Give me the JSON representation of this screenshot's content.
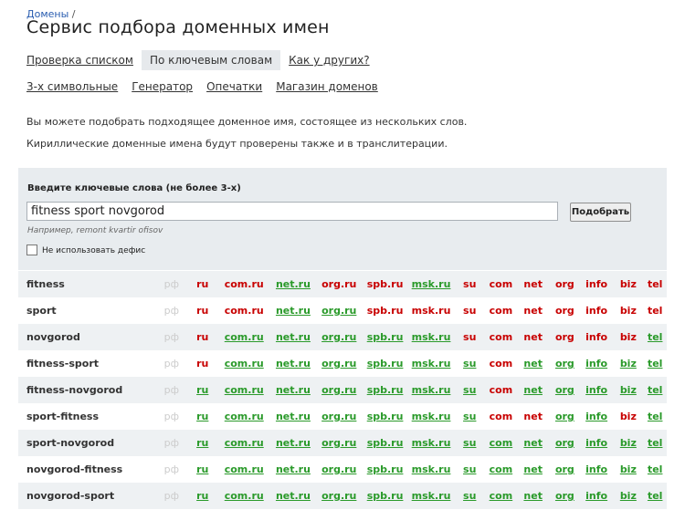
{
  "breadcrumb": {
    "link": "Домены",
    "separator": "/"
  },
  "title": "Сервис подбора доменных имен",
  "tabs": [
    {
      "label": "Проверка списком",
      "active": false
    },
    {
      "label": "По ключевым словам",
      "active": true
    },
    {
      "label": "Как у других?",
      "active": false
    }
  ],
  "subnav": [
    "3-х символьные",
    "Генератор",
    "Опечатки",
    "Магазин доменов"
  ],
  "description": [
    "Вы можете подобрать подходящее доменное имя, состоящее из нескольких слов.",
    "Кириллические доменные имена будут проверены также и в транслитерации."
  ],
  "form": {
    "label": "Введите ключевые слова (не более 3-х)",
    "query_value": "fitness sport novgorod",
    "submit_label": "Подобрать",
    "hint": "Например, remont kvartir ofisov",
    "no_hyphen_label": "Не использовать дефис",
    "no_hyphen_checked": false
  },
  "colors": {
    "taken": "#c80000",
    "free": "#2a9a2a",
    "disabled": "#cccccc",
    "panel": "#e8ecef"
  },
  "zones": [
    "рф",
    "ru",
    "com.ru",
    "net.ru",
    "org.ru",
    "spb.ru",
    "msk.ru",
    "su",
    "com",
    "net",
    "org",
    "info",
    "biz",
    "tel"
  ],
  "rows": [
    {
      "word": "fitness",
      "status": [
        "disabled",
        "taken",
        "taken",
        "free",
        "taken",
        "taken",
        "free",
        "taken",
        "taken",
        "taken",
        "taken",
        "taken",
        "taken",
        "taken"
      ]
    },
    {
      "word": "sport",
      "status": [
        "disabled",
        "taken",
        "taken",
        "free",
        "free",
        "taken",
        "taken",
        "taken",
        "taken",
        "taken",
        "taken",
        "taken",
        "taken",
        "taken"
      ]
    },
    {
      "word": "novgorod",
      "status": [
        "disabled",
        "taken",
        "free",
        "free",
        "free",
        "free",
        "free",
        "taken",
        "taken",
        "taken",
        "taken",
        "taken",
        "taken",
        "free"
      ]
    },
    {
      "word": "fitness-sport",
      "status": [
        "disabled",
        "taken",
        "free",
        "free",
        "free",
        "free",
        "free",
        "free",
        "taken",
        "free",
        "free",
        "free",
        "free",
        "free"
      ]
    },
    {
      "word": "fitness-novgorod",
      "status": [
        "disabled",
        "free",
        "free",
        "free",
        "free",
        "free",
        "free",
        "free",
        "taken",
        "free",
        "free",
        "free",
        "free",
        "free"
      ]
    },
    {
      "word": "sport-fitness",
      "status": [
        "disabled",
        "free",
        "free",
        "free",
        "free",
        "free",
        "free",
        "free",
        "taken",
        "taken",
        "free",
        "free",
        "taken",
        "free"
      ]
    },
    {
      "word": "sport-novgorod",
      "status": [
        "disabled",
        "free",
        "free",
        "free",
        "free",
        "free",
        "free",
        "free",
        "free",
        "free",
        "free",
        "free",
        "free",
        "free"
      ]
    },
    {
      "word": "novgorod-fitness",
      "status": [
        "disabled",
        "free",
        "free",
        "free",
        "free",
        "free",
        "free",
        "free",
        "free",
        "free",
        "free",
        "free",
        "free",
        "free"
      ]
    },
    {
      "word": "novgorod-sport",
      "status": [
        "disabled",
        "free",
        "free",
        "free",
        "free",
        "free",
        "free",
        "free",
        "free",
        "free",
        "free",
        "free",
        "free",
        "free"
      ]
    }
  ]
}
